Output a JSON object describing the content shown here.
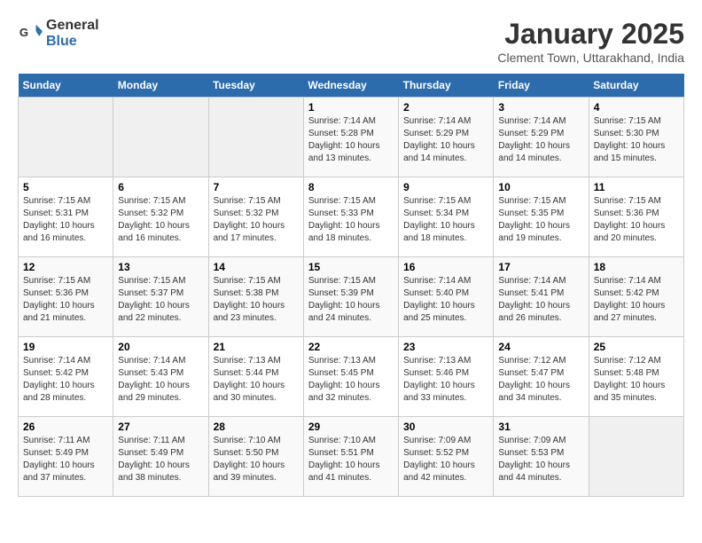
{
  "header": {
    "logo_general": "General",
    "logo_blue": "Blue",
    "title": "January 2025",
    "subtitle": "Clement Town, Uttarakhand, India"
  },
  "days_of_week": [
    "Sunday",
    "Monday",
    "Tuesday",
    "Wednesday",
    "Thursday",
    "Friday",
    "Saturday"
  ],
  "weeks": [
    [
      {
        "day": "",
        "info": ""
      },
      {
        "day": "",
        "info": ""
      },
      {
        "day": "",
        "info": ""
      },
      {
        "day": "1",
        "info": "Sunrise: 7:14 AM\nSunset: 5:28 PM\nDaylight: 10 hours\nand 13 minutes."
      },
      {
        "day": "2",
        "info": "Sunrise: 7:14 AM\nSunset: 5:29 PM\nDaylight: 10 hours\nand 14 minutes."
      },
      {
        "day": "3",
        "info": "Sunrise: 7:14 AM\nSunset: 5:29 PM\nDaylight: 10 hours\nand 14 minutes."
      },
      {
        "day": "4",
        "info": "Sunrise: 7:15 AM\nSunset: 5:30 PM\nDaylight: 10 hours\nand 15 minutes."
      }
    ],
    [
      {
        "day": "5",
        "info": "Sunrise: 7:15 AM\nSunset: 5:31 PM\nDaylight: 10 hours\nand 16 minutes."
      },
      {
        "day": "6",
        "info": "Sunrise: 7:15 AM\nSunset: 5:32 PM\nDaylight: 10 hours\nand 16 minutes."
      },
      {
        "day": "7",
        "info": "Sunrise: 7:15 AM\nSunset: 5:32 PM\nDaylight: 10 hours\nand 17 minutes."
      },
      {
        "day": "8",
        "info": "Sunrise: 7:15 AM\nSunset: 5:33 PM\nDaylight: 10 hours\nand 18 minutes."
      },
      {
        "day": "9",
        "info": "Sunrise: 7:15 AM\nSunset: 5:34 PM\nDaylight: 10 hours\nand 18 minutes."
      },
      {
        "day": "10",
        "info": "Sunrise: 7:15 AM\nSunset: 5:35 PM\nDaylight: 10 hours\nand 19 minutes."
      },
      {
        "day": "11",
        "info": "Sunrise: 7:15 AM\nSunset: 5:36 PM\nDaylight: 10 hours\nand 20 minutes."
      }
    ],
    [
      {
        "day": "12",
        "info": "Sunrise: 7:15 AM\nSunset: 5:36 PM\nDaylight: 10 hours\nand 21 minutes."
      },
      {
        "day": "13",
        "info": "Sunrise: 7:15 AM\nSunset: 5:37 PM\nDaylight: 10 hours\nand 22 minutes."
      },
      {
        "day": "14",
        "info": "Sunrise: 7:15 AM\nSunset: 5:38 PM\nDaylight: 10 hours\nand 23 minutes."
      },
      {
        "day": "15",
        "info": "Sunrise: 7:15 AM\nSunset: 5:39 PM\nDaylight: 10 hours\nand 24 minutes."
      },
      {
        "day": "16",
        "info": "Sunrise: 7:14 AM\nSunset: 5:40 PM\nDaylight: 10 hours\nand 25 minutes."
      },
      {
        "day": "17",
        "info": "Sunrise: 7:14 AM\nSunset: 5:41 PM\nDaylight: 10 hours\nand 26 minutes."
      },
      {
        "day": "18",
        "info": "Sunrise: 7:14 AM\nSunset: 5:42 PM\nDaylight: 10 hours\nand 27 minutes."
      }
    ],
    [
      {
        "day": "19",
        "info": "Sunrise: 7:14 AM\nSunset: 5:42 PM\nDaylight: 10 hours\nand 28 minutes."
      },
      {
        "day": "20",
        "info": "Sunrise: 7:14 AM\nSunset: 5:43 PM\nDaylight: 10 hours\nand 29 minutes."
      },
      {
        "day": "21",
        "info": "Sunrise: 7:13 AM\nSunset: 5:44 PM\nDaylight: 10 hours\nand 30 minutes."
      },
      {
        "day": "22",
        "info": "Sunrise: 7:13 AM\nSunset: 5:45 PM\nDaylight: 10 hours\nand 32 minutes."
      },
      {
        "day": "23",
        "info": "Sunrise: 7:13 AM\nSunset: 5:46 PM\nDaylight: 10 hours\nand 33 minutes."
      },
      {
        "day": "24",
        "info": "Sunrise: 7:12 AM\nSunset: 5:47 PM\nDaylight: 10 hours\nand 34 minutes."
      },
      {
        "day": "25",
        "info": "Sunrise: 7:12 AM\nSunset: 5:48 PM\nDaylight: 10 hours\nand 35 minutes."
      }
    ],
    [
      {
        "day": "26",
        "info": "Sunrise: 7:11 AM\nSunset: 5:49 PM\nDaylight: 10 hours\nand 37 minutes."
      },
      {
        "day": "27",
        "info": "Sunrise: 7:11 AM\nSunset: 5:49 PM\nDaylight: 10 hours\nand 38 minutes."
      },
      {
        "day": "28",
        "info": "Sunrise: 7:10 AM\nSunset: 5:50 PM\nDaylight: 10 hours\nand 39 minutes."
      },
      {
        "day": "29",
        "info": "Sunrise: 7:10 AM\nSunset: 5:51 PM\nDaylight: 10 hours\nand 41 minutes."
      },
      {
        "day": "30",
        "info": "Sunrise: 7:09 AM\nSunset: 5:52 PM\nDaylight: 10 hours\nand 42 minutes."
      },
      {
        "day": "31",
        "info": "Sunrise: 7:09 AM\nSunset: 5:53 PM\nDaylight: 10 hours\nand 44 minutes."
      },
      {
        "day": "",
        "info": ""
      }
    ]
  ]
}
